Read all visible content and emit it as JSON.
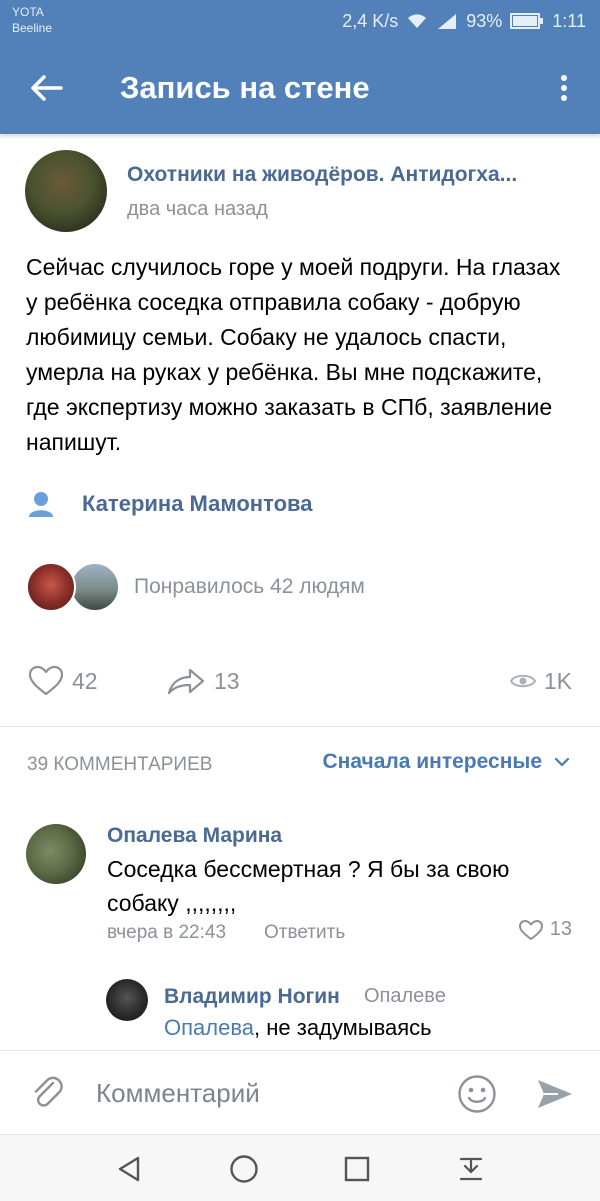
{
  "status_bar": {
    "carrier1": "YOTA",
    "carrier2": "Beeline",
    "speed": "2,4 K/s",
    "battery": "93%",
    "time": "1:11"
  },
  "toolbar": {
    "title": "Запись на стене"
  },
  "post": {
    "author": "Охотники на живодёров. Антидогха...",
    "time": "два часа назад",
    "text": "Сейчас случилось горе у моей подруги. На глазах у ребёнка соседка отправила собаку - добрую любимицу семьи. Собаку не удалось спасти, умерла на руках у ребёнка. Вы мне подскажите, где экспертизу можно заказать в СПб, заявление напишут.",
    "signer": "Катерина Мамонтова",
    "liked_by": "Понравилось 42 людям",
    "likes": "42",
    "shares": "13",
    "views": "1K"
  },
  "comments_header": {
    "count": "39 КОММЕНТАРИЕВ",
    "sort": "Сначала интересные"
  },
  "comments": [
    {
      "author": "Опалева Марина",
      "text": "Соседка бессмертная ? Я бы за свою собаку ,,,,,,,,",
      "time": "вчера в 22:43",
      "reply": "Ответить",
      "likes": "13"
    },
    {
      "author": "Владимир Ногин",
      "reply_to": "Опалеве",
      "mention": "Опалева",
      "text": ", не задумываясь"
    }
  ],
  "composer": {
    "placeholder": "Комментарий"
  },
  "colors": {
    "header": "#5181b8",
    "link": "#4a6a94",
    "accent": "#4a7ab3",
    "muted": "#8c9199"
  },
  "icons": [
    "back-arrow-icon",
    "more-vertical-icon",
    "person-icon",
    "heart-icon",
    "share-icon",
    "eye-icon",
    "chevron-down-icon",
    "paperclip-icon",
    "emoji-icon",
    "send-icon",
    "nav-back-icon",
    "nav-home-icon",
    "nav-recent-icon",
    "nav-down-icon"
  ]
}
